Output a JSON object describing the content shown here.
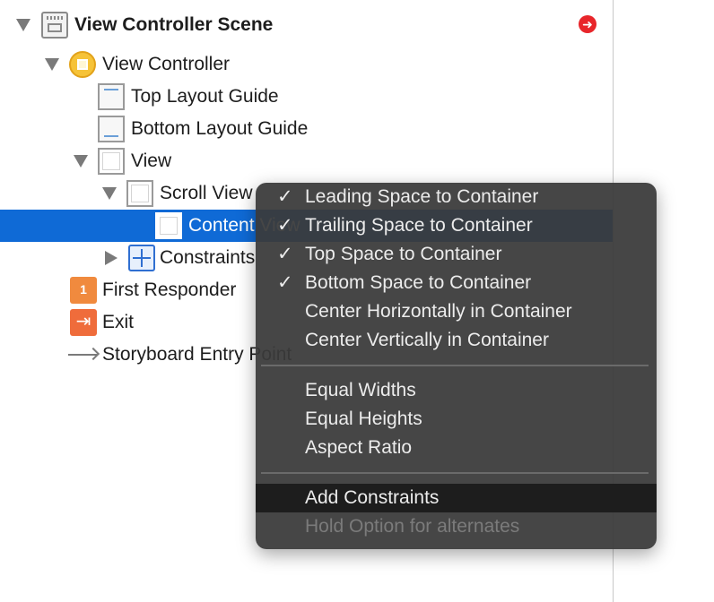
{
  "outline": {
    "scene_title": "View Controller Scene",
    "view_controller": "View Controller",
    "top_layout_guide": "Top Layout Guide",
    "bottom_layout_guide": "Bottom Layout Guide",
    "view": "View",
    "scroll_view": "Scroll View",
    "content_view": "Content View",
    "constraints": "Constraints",
    "first_responder": "First Responder",
    "exit": "Exit",
    "storyboard_entry": "Storyboard Entry Point",
    "first_responder_badge": "1",
    "exit_glyph": "⇥",
    "warning_glyph": "➜"
  },
  "menu": {
    "check_glyph": "✓",
    "items": [
      {
        "label": "Leading Space to Container",
        "checked": true
      },
      {
        "label": "Trailing Space to Container",
        "checked": true
      },
      {
        "label": "Top Space to Container",
        "checked": true
      },
      {
        "label": "Bottom Space to Container",
        "checked": true
      },
      {
        "label": "Center Horizontally in Container",
        "checked": false
      },
      {
        "label": "Center Vertically in Container",
        "checked": false
      },
      {
        "label": "Equal Widths",
        "checked": false
      },
      {
        "label": "Equal Heights",
        "checked": false
      },
      {
        "label": "Aspect Ratio",
        "checked": false
      },
      {
        "label": "Add Constraints",
        "checked": false,
        "highlighted": true
      },
      {
        "label": "Hold Option for alternates",
        "checked": false,
        "disabled": true
      }
    ]
  },
  "colors": {
    "selection": "#0f6ad6",
    "menu_background": "#3a3a3a",
    "warning": "#e8262b"
  }
}
